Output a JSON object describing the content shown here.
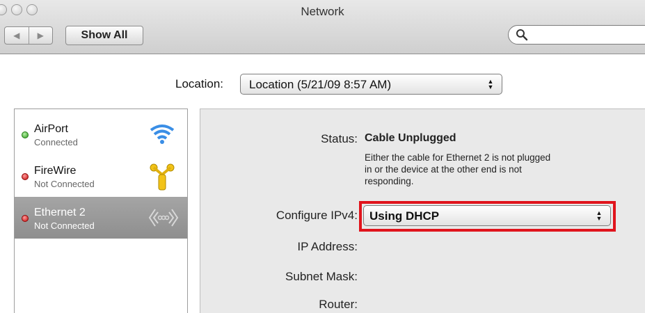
{
  "window": {
    "title": "Network"
  },
  "toolbar": {
    "back": "◀",
    "forward": "▶",
    "show_all": "Show All",
    "search_placeholder": ""
  },
  "location": {
    "label": "Location:",
    "value": "Location (5/21/09 8:57 AM)"
  },
  "services": [
    {
      "name": "AirPort",
      "status": "Connected",
      "status_color": "#2d9b1d",
      "icon": "wifi-icon"
    },
    {
      "name": "FireWire",
      "status": "Not Connected",
      "status_color": "#c40b0b",
      "icon": "firewire-icon"
    },
    {
      "name": "Ethernet 2",
      "status": "Not Connected",
      "status_color": "#c40b0b",
      "icon": "ethernet-icon",
      "selected": true
    }
  ],
  "detail": {
    "status_label": "Status:",
    "status_value": "Cable Unplugged",
    "status_desc_lines": [
      "Either the cable for Ethernet 2 is not plugged",
      "in or the device at the other end is not",
      "responding."
    ],
    "configure_label": "Configure IPv4:",
    "configure_value": "Using DHCP",
    "ip_label": "IP Address:",
    "subnet_label": "Subnet Mask:",
    "router_label": "Router:"
  },
  "highlight_color": "#e0141c"
}
